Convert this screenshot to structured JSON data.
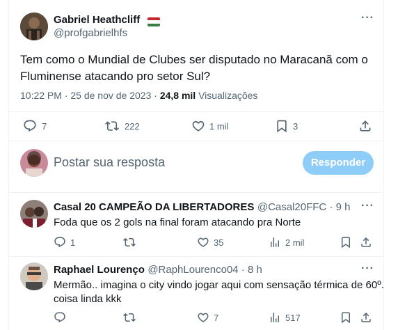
{
  "main_tweet": {
    "author_name": "Gabriel Heathcliff",
    "handle": "@profgabrielhfs",
    "text_line1": "Tem como o Mundial de Clubes ser disputado no Maracanã com o",
    "text_line2": "Fluminense atacando pro setor Sul?",
    "time": "10:22 PM · 25 de nov de 2023 · ",
    "views_count": "24,8 mil",
    "views_label": "Visualizações",
    "replies": "7",
    "retweets": "222",
    "likes": "1 mil",
    "bookmarks": "3"
  },
  "compose": {
    "placeholder": "Postar sua resposta",
    "button_label": "Responder"
  },
  "replies": [
    {
      "author_name": "Casal 20 CAMPEÃO DA LIBERTADORES",
      "handle": "@Casal20FFC · 9 h",
      "text": "Foda que os 2 gols na final foram atacando pra Norte",
      "replies": "1",
      "likes": "35",
      "views": "2 mil"
    },
    {
      "author_name": "Raphael Lourenço",
      "handle": "@RaphLourenco04 · 8 h",
      "text_line1": "Mermão.. imagina o city vindo jogar aqui com sensação térmica de 60º..",
      "text_line2": "coisa linda kkk",
      "likes": "7",
      "views": "517"
    }
  ],
  "more_glyph": "···",
  "colors": {
    "accent": "#1d9bf0",
    "button_disabled": "#8ecdf8",
    "muted": "#536471",
    "divider": "#eff3f4",
    "flag_red": "#c4272f",
    "flag_green": "#3a7d44"
  },
  "icons": [
    "reply-icon",
    "retweet-icon",
    "like-icon",
    "bookmark-icon",
    "share-icon",
    "views-icon",
    "more-icon",
    "hungary-flag-icon"
  ]
}
